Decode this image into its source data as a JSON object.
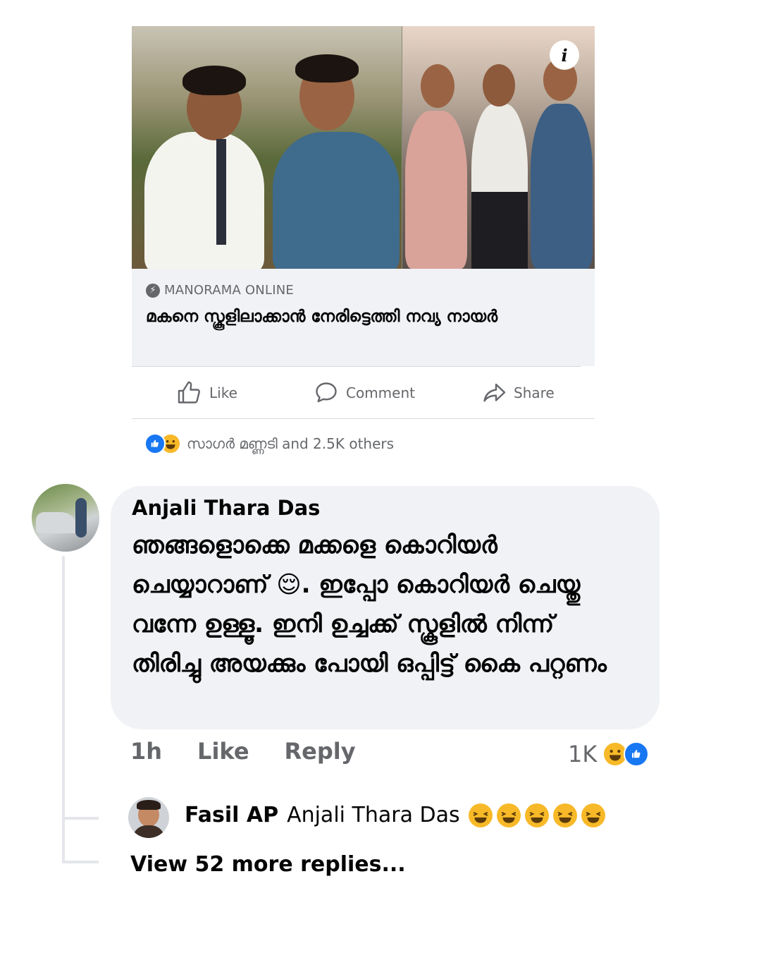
{
  "post": {
    "image_alt": "Photo collage: boy in school uniform with mother",
    "info_icon": "i",
    "link_source": "MANORAMA ONLINE",
    "link_headline": "മകനെ സ്കൂളിലാക്കാൻ നേരിട്ടെത്തി നവ്യ നായർ"
  },
  "actions": {
    "like": "Like",
    "comment": "Comment",
    "share": "Share"
  },
  "reactions": {
    "summary": "സാഗർ മണ്ണടി and 2.5K others"
  },
  "comment": {
    "author": "Anjali Thara Das",
    "text": "ഞങ്ങളൊക്കെ മക്കളെ കൊറിയർ ചെയ്യാറാണ് 😌. ഇപ്പോ കൊറിയർ ചെയ്തു വന്നേ ഉള്ളൂ. ഇനി ഉച്ചക്ക് സ്കൂളിൽ നിന്ന് തിരിച്ചു അയക്കും പോയി ഒപ്പിട്ട് കൈ പറ്റണം",
    "time": "1h",
    "like_label": "Like",
    "reply_label": "Reply",
    "reaction_count": "1K"
  },
  "reply": {
    "author": "Fasil AP",
    "text": "Anjali Thara Das"
  },
  "view_more": "View 52 more replies...",
  "colors": {
    "accent": "#1877f2",
    "haha": "#f7b928",
    "bubble": "#f0f2f5",
    "muted_text": "#65676b"
  }
}
